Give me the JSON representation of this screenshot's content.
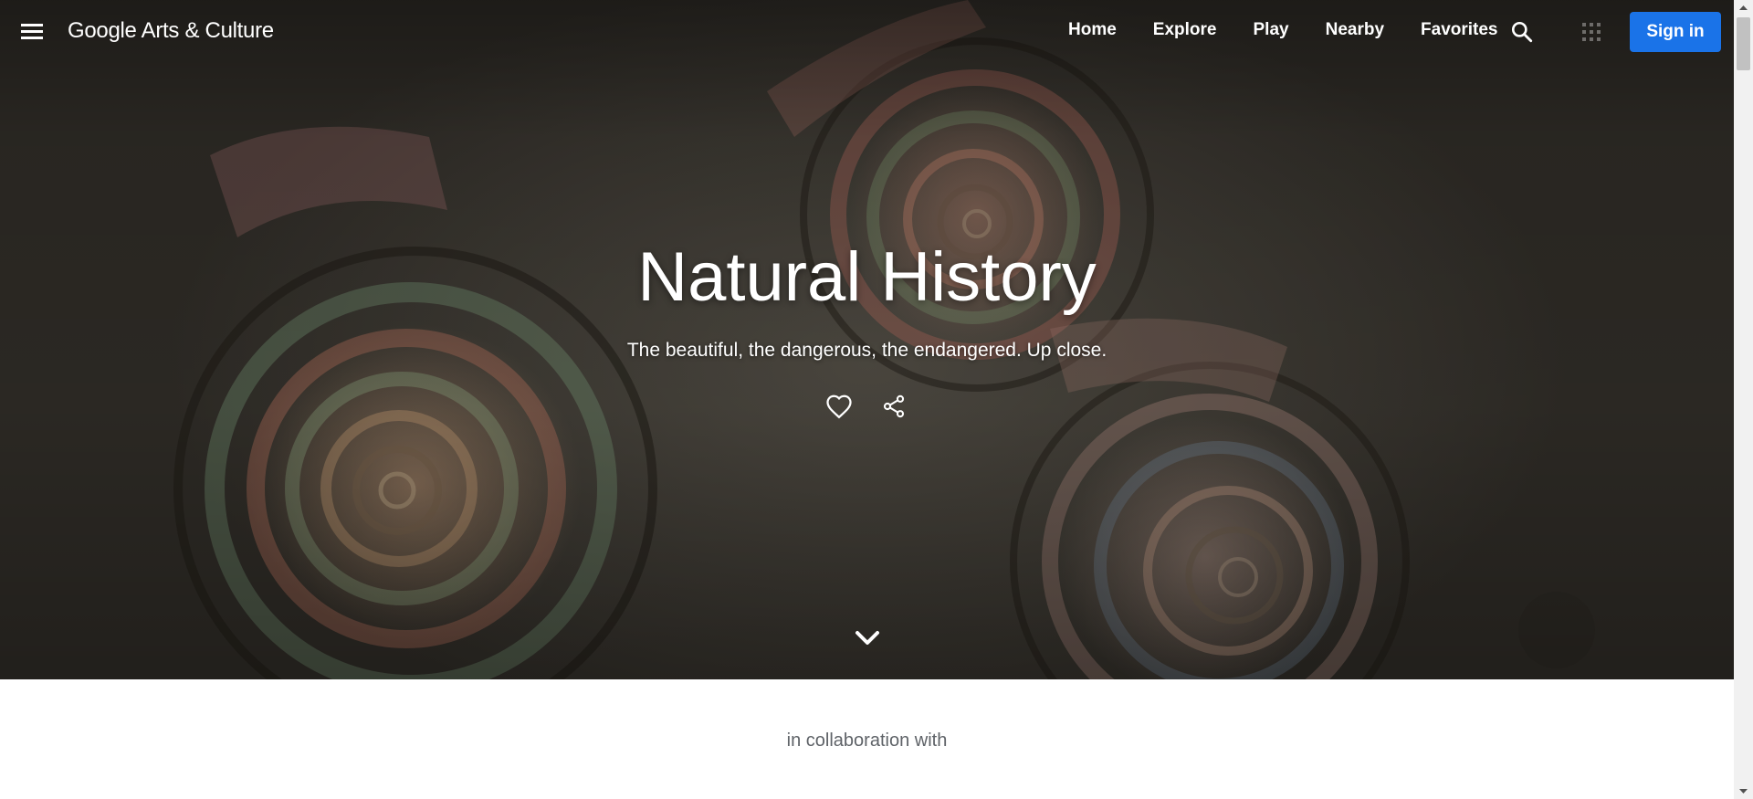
{
  "header": {
    "logo": "Google Arts & Culture",
    "nav": [
      "Home",
      "Explore",
      "Play",
      "Nearby",
      "Favorites"
    ],
    "signin_label": "Sign in"
  },
  "hero": {
    "title": "Natural History",
    "subtitle": "The beautiful, the dangerous, the endangered. Up close."
  },
  "collab": {
    "text": "in collaboration with"
  },
  "icons": {
    "menu": "hamburger-menu-icon",
    "search": "search-icon",
    "apps": "apps-grid-icon",
    "favorite": "heart-icon",
    "share": "share-icon",
    "scroll": "chevron-down-icon"
  },
  "colors": {
    "signin_bg": "#1a73e8",
    "collab_text": "#5f6368"
  }
}
